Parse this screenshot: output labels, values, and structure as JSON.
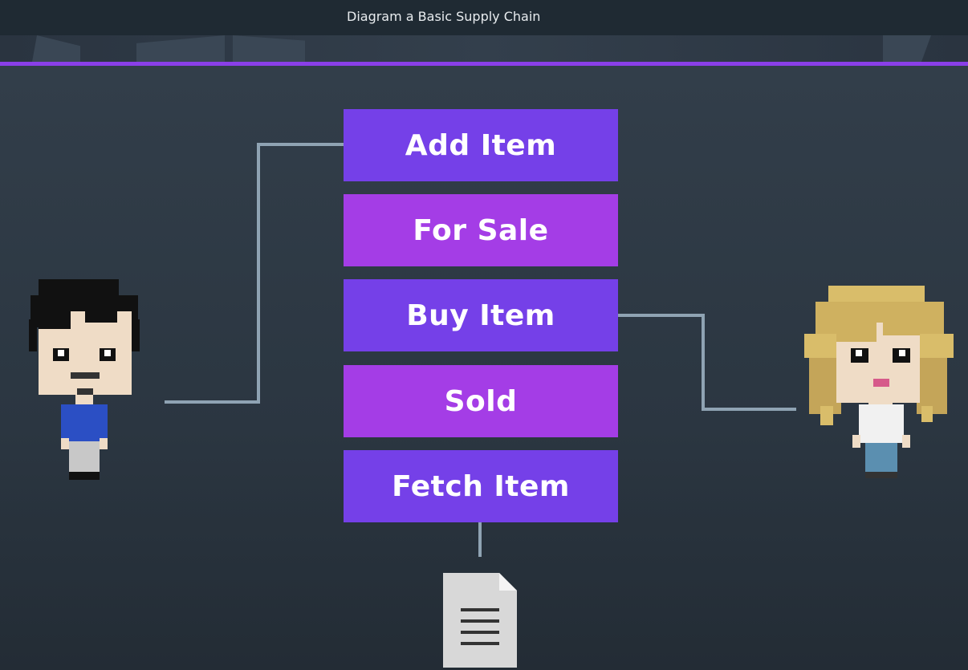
{
  "window": {
    "title": "Diagram a Basic Supply Chain"
  },
  "diagram": {
    "steps": [
      "Add Item",
      "For Sale",
      "Buy Item",
      "Sold",
      "Fetch Item"
    ]
  },
  "colors": {
    "accent": "#8a3fe8",
    "step_blue": "#7540e8",
    "step_magenta": "#a43de6",
    "connector": "#8fa3b3"
  },
  "icons": {
    "left": "farmer-avatar-icon",
    "right": "customer-avatar-icon",
    "bottom": "document-icon"
  }
}
